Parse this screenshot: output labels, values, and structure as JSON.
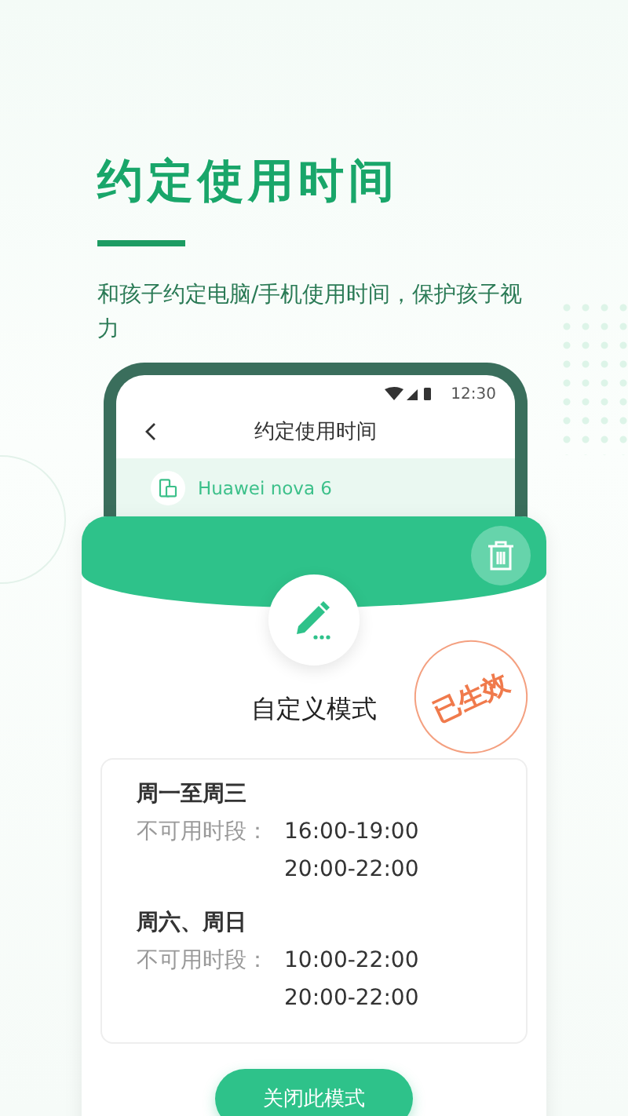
{
  "heading": {
    "title": "约定使用时间",
    "subtitle": "和孩子约定电脑/手机使用时间，保护孩子视力"
  },
  "phone": {
    "status_bar": {
      "time": "12:30"
    },
    "nav": {
      "title": "约定使用时间"
    },
    "device": {
      "name": "Huawei nova 6"
    }
  },
  "card": {
    "mode_title": "自定义模式",
    "stamp": "已生效",
    "schedules": [
      {
        "days": "周一至周三",
        "label": "不可用时段：",
        "times": [
          "16:00-19:00",
          "20:00-22:00"
        ]
      },
      {
        "days": "周六、周日",
        "label": "不可用时段：",
        "times": [
          "10:00-22:00",
          "20:00-22:00"
        ]
      }
    ],
    "button": "关闭此模式"
  }
}
